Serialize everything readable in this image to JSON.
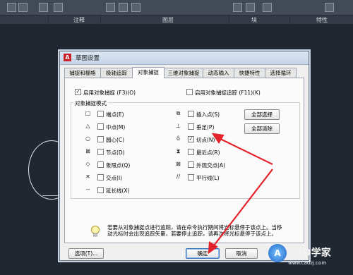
{
  "ribbon": {
    "panels": [
      "注释",
      "图层",
      "块",
      "特性"
    ]
  },
  "dialog": {
    "title": "草图设置",
    "tabs": [
      "捕捉和栅格",
      "极轴追踪",
      "对象捕捉",
      "三维对象捕捉",
      "动态输入",
      "快捷特性",
      "选择循环"
    ],
    "active_tab": "对象捕捉",
    "enable_osnap": {
      "label": "启用对象捕捉 (F3)(O)",
      "checked": true
    },
    "enable_tracking": {
      "label": "启用对象捕捉追踪 (F11)(K)",
      "checked": false
    },
    "group_title": "对象捕捉模式",
    "modes_left": [
      {
        "label": "端点(E)",
        "symbol": "□",
        "checked": false
      },
      {
        "label": "中点(M)",
        "symbol": "△",
        "checked": false
      },
      {
        "label": "圆心(C)",
        "symbol": "○",
        "checked": false
      },
      {
        "label": "节点(D)",
        "symbol": "⊠",
        "checked": false
      },
      {
        "label": "象限点(Q)",
        "symbol": "◇",
        "checked": false
      },
      {
        "label": "交点(I)",
        "symbol": "✕",
        "checked": false
      },
      {
        "label": "延长线(X)",
        "symbol": "--",
        "checked": false
      }
    ],
    "modes_right": [
      {
        "label": "插入点(S)",
        "symbol": "⧉",
        "checked": false
      },
      {
        "label": "垂足(P)",
        "symbol": "⊥",
        "checked": false
      },
      {
        "label": "切点(N)",
        "symbol": "ȏ",
        "checked": true
      },
      {
        "label": "最近点(R)",
        "symbol": "⧗",
        "checked": false
      },
      {
        "label": "外观交点(A)",
        "symbol": "⊠",
        "checked": false
      },
      {
        "label": "平行线(L)",
        "symbol": "//",
        "checked": false
      }
    ],
    "select_all_label": "全部选择",
    "clear_all_label": "全部清除",
    "hint_text": "若要从对象捕捉点进行追踪，请在命令执行期间将光标悬停于该点上。当移动光标时会出现追踪矢量，若要停止追踪，请再次将光标悬停于该点上。",
    "options_label": "选项(T)...",
    "ok_label": "确定",
    "cancel_label": "取消"
  },
  "watermark": {
    "logo": "A",
    "text": "CAD学家",
    "url": "www.cadzj.com"
  },
  "colors": {
    "annotation_arrow": "#e4222b"
  }
}
